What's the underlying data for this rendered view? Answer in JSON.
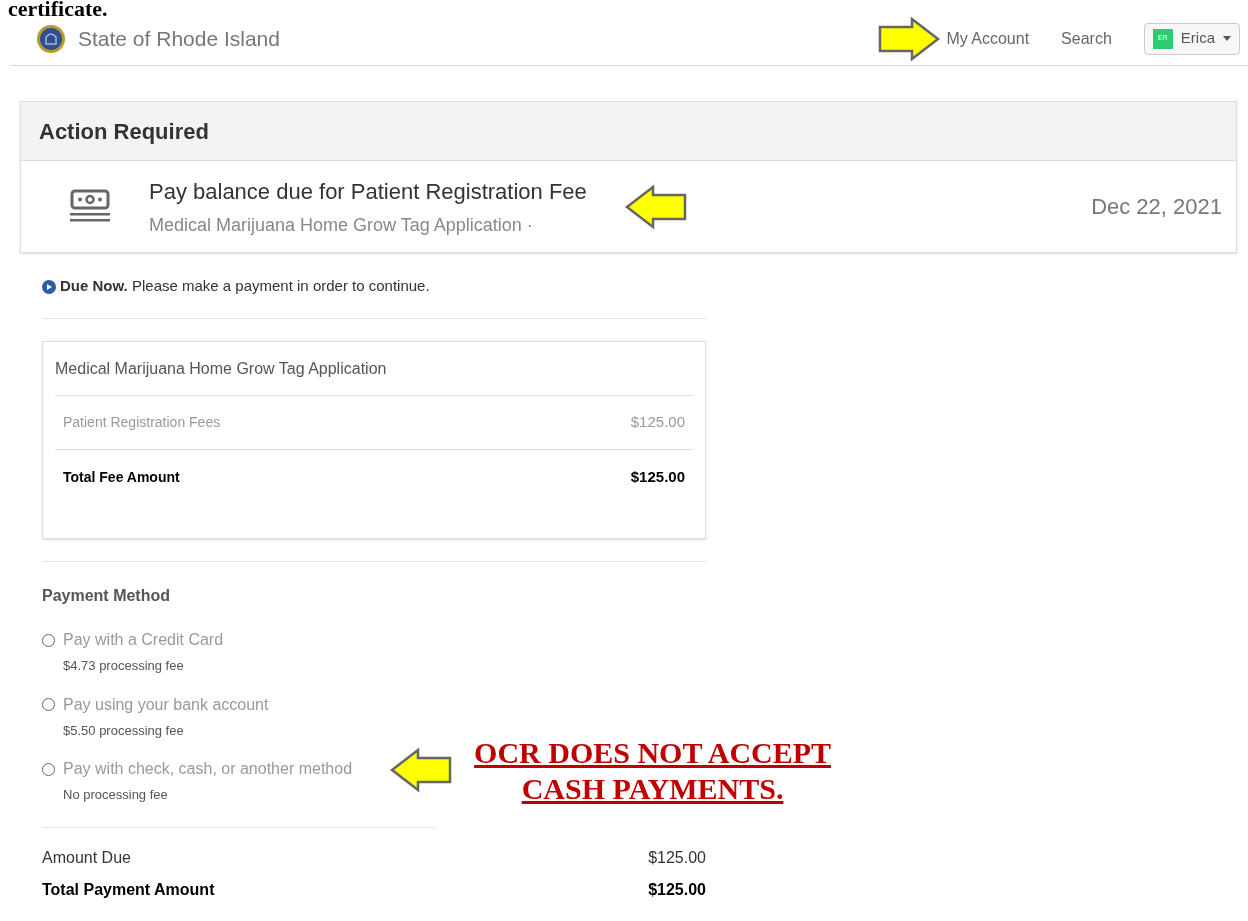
{
  "doc_heading": "certificate.",
  "header": {
    "site_title": "State of Rhode Island",
    "nav": [
      {
        "label": "My Account",
        "annotated": true
      },
      {
        "label": "Search",
        "annotated": false
      }
    ],
    "user": {
      "initials": "ER",
      "name": "Erica"
    }
  },
  "action_card": {
    "title": "Action Required",
    "task": {
      "title": "Pay balance due for Patient Registration Fee",
      "subtitle": "Medical Marijuana Home Grow Tag Application ·",
      "date": "Dec 22, 2021",
      "annotated": true
    }
  },
  "notice": "**Due Now.** Please make a payment in order to continue.",
  "fee_card": {
    "title": "Medical Marijuana Home Grow Tag Application",
    "rows": [
      {
        "label": "Patient Registration Fees",
        "amount": "$125.00",
        "kind": "item"
      },
      {
        "label": "Total Fee Amount",
        "amount": "$125.00",
        "kind": "total"
      }
    ]
  },
  "payment": {
    "heading": "Payment Method",
    "options": [
      {
        "label": "Pay with a Credit Card",
        "fee": "$4.73 processing fee",
        "selected": false,
        "annotated": false
      },
      {
        "label": "Pay using your bank account",
        "fee": "$5.50 processing fee",
        "selected": false,
        "annotated": false
      },
      {
        "label": "Pay with check, cash, or another method",
        "fee": "No processing fee",
        "selected": false,
        "annotated": true
      }
    ]
  },
  "annotation": [
    "OCR DOES NOT ACCEPT",
    "CASH PAYMENTS."
  ],
  "summary": [
    {
      "label": "Amount Due",
      "amount": "$125.00",
      "kind": "item"
    },
    {
      "label": "Total Payment Amount",
      "amount": "$125.00",
      "kind": "total"
    }
  ]
}
